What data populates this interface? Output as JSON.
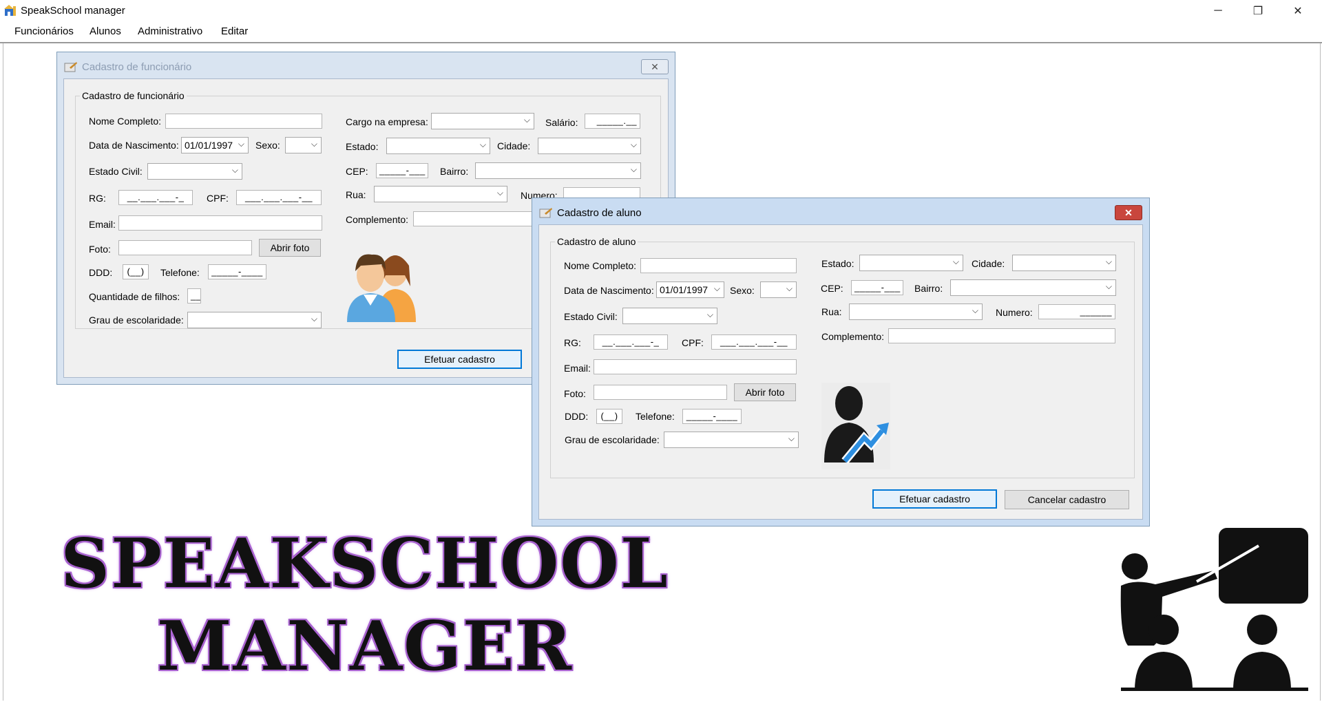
{
  "app": {
    "title": "SpeakSchool manager",
    "minimize": "─",
    "restore": "❐",
    "close": "✕"
  },
  "menu": [
    "Funcionários",
    "Alunos",
    "Administrativo",
    "Editar"
  ],
  "funcionario": {
    "window_title": "Cadastro de funcionário",
    "group_title": "Cadastro de funcionário",
    "nome_label": "Nome Completo:",
    "nasc_label": "Data de Nascimento:",
    "nasc_value": "01/01/1997",
    "sexo_label": "Sexo:",
    "civil_label": "Estado Civil:",
    "rg_label": "RG:",
    "rg_mask": "__.___.___-_",
    "cpf_label": "CPF:",
    "cpf_mask": "___.___.___-__",
    "email_label": "Email:",
    "foto_label": "Foto:",
    "abrir_foto": "Abrir foto",
    "ddd_label": "DDD:",
    "ddd_mask": "(__)",
    "tel_label": "Telefone:",
    "tel_mask": "_____-____",
    "filhos_label": "Quantidade de filhos:",
    "filhos_mask": "__",
    "grau_label": "Grau de escolaridade:",
    "cargo_label": "Cargo na empresa:",
    "salario_label": "Salário:",
    "salario_mask": "_____.__",
    "estado_label": "Estado:",
    "cidade_label": "Cidade:",
    "cep_label": "CEP:",
    "cep_mask": "_____-___",
    "bairro_label": "Bairro:",
    "rua_label": "Rua:",
    "numero_label": "Numero:",
    "complemento_label": "Complemento:",
    "efetuar": "Efetuar cadastro",
    "image_icon": "people-icon"
  },
  "aluno": {
    "window_title": "Cadastro de aluno",
    "group_title": "Cadastro de aluno",
    "nome_label": "Nome Completo:",
    "nasc_label": "Data de Nascimento:",
    "nasc_value": "01/01/1997",
    "sexo_label": "Sexo:",
    "civil_label": "Estado Civil:",
    "rg_label": "RG:",
    "rg_mask": "__.___.___-_",
    "cpf_label": "CPF:",
    "cpf_mask": "___.___.___-__",
    "email_label": "Email:",
    "foto_label": "Foto:",
    "abrir_foto": "Abrir foto",
    "ddd_label": "DDD:",
    "ddd_mask": "(__)",
    "tel_label": "Telefone:",
    "tel_mask": "_____-____",
    "grau_label": "Grau de escolaridade:",
    "estado_label": "Estado:",
    "cidade_label": "Cidade:",
    "cep_label": "CEP:",
    "cep_mask": "_____-___",
    "bairro_label": "Bairro:",
    "rua_label": "Rua:",
    "numero_label": "Numero:",
    "numero_mask": "______",
    "complemento_label": "Complemento:",
    "efetuar": "Efetuar cadastro",
    "cancelar": "Cancelar cadastro",
    "image_icon": "student-growth-icon"
  },
  "branding": {
    "line1": "SPEAKSCHOOL",
    "line2": "MANAGER",
    "logo_icon": "teacher-classroom-icon"
  },
  "colors": {
    "brand_glow": "#b36cd9",
    "default_button_border": "#0078d7",
    "close_red": "#c9463d"
  }
}
